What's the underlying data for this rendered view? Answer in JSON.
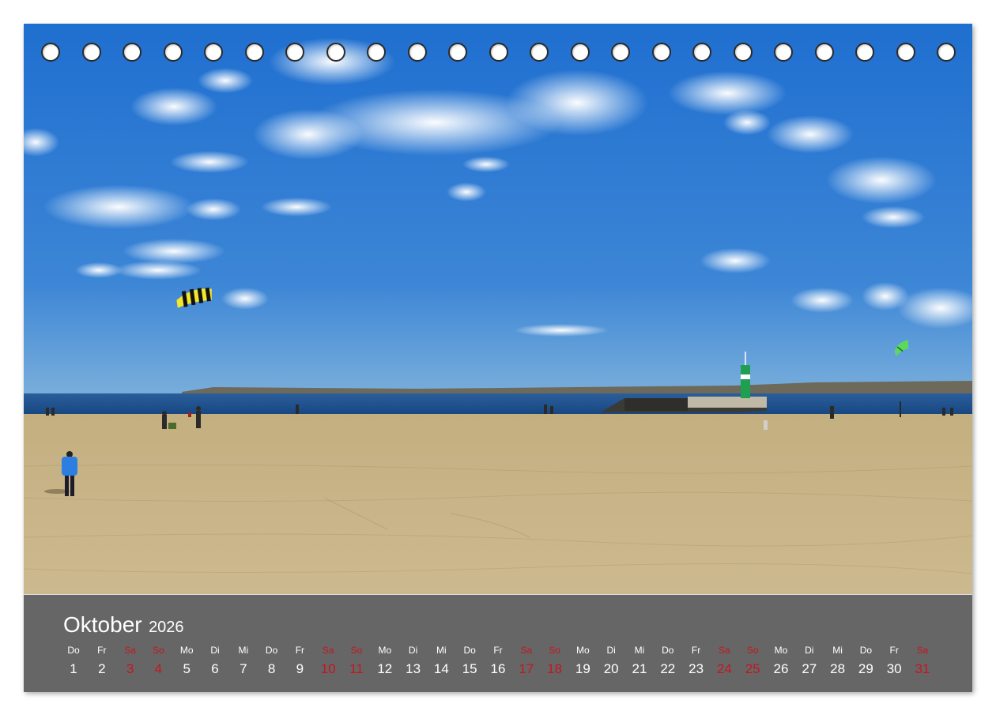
{
  "calendar": {
    "month": "Oktober",
    "year": "2026",
    "colors": {
      "panel": "#666666",
      "text": "#ffffff",
      "weekend": "#c8141e"
    },
    "days": [
      {
        "dow": "Do",
        "num": "1",
        "weekend": false
      },
      {
        "dow": "Fr",
        "num": "2",
        "weekend": false
      },
      {
        "dow": "Sa",
        "num": "3",
        "weekend": true
      },
      {
        "dow": "So",
        "num": "4",
        "weekend": true
      },
      {
        "dow": "Mo",
        "num": "5",
        "weekend": false
      },
      {
        "dow": "Di",
        "num": "6",
        "weekend": false
      },
      {
        "dow": "Mi",
        "num": "7",
        "weekend": false
      },
      {
        "dow": "Do",
        "num": "8",
        "weekend": false
      },
      {
        "dow": "Fr",
        "num": "9",
        "weekend": false
      },
      {
        "dow": "Sa",
        "num": "10",
        "weekend": true
      },
      {
        "dow": "So",
        "num": "11",
        "weekend": true
      },
      {
        "dow": "Mo",
        "num": "12",
        "weekend": false
      },
      {
        "dow": "Di",
        "num": "13",
        "weekend": false
      },
      {
        "dow": "Mi",
        "num": "14",
        "weekend": false
      },
      {
        "dow": "Do",
        "num": "15",
        "weekend": false
      },
      {
        "dow": "Fr",
        "num": "16",
        "weekend": false
      },
      {
        "dow": "Sa",
        "num": "17",
        "weekend": true
      },
      {
        "dow": "So",
        "num": "18",
        "weekend": true
      },
      {
        "dow": "Mo",
        "num": "19",
        "weekend": false
      },
      {
        "dow": "Di",
        "num": "20",
        "weekend": false
      },
      {
        "dow": "Mi",
        "num": "21",
        "weekend": false
      },
      {
        "dow": "Do",
        "num": "22",
        "weekend": false
      },
      {
        "dow": "Fr",
        "num": "23",
        "weekend": false
      },
      {
        "dow": "Sa",
        "num": "24",
        "weekend": true
      },
      {
        "dow": "So",
        "num": "25",
        "weekend": true
      },
      {
        "dow": "Mo",
        "num": "26",
        "weekend": false
      },
      {
        "dow": "Di",
        "num": "27",
        "weekend": false
      },
      {
        "dow": "Mi",
        "num": "28",
        "weekend": false
      },
      {
        "dow": "Do",
        "num": "29",
        "weekend": false
      },
      {
        "dow": "Fr",
        "num": "30",
        "weekend": false
      },
      {
        "dow": "Sa",
        "num": "31",
        "weekend": true
      }
    ]
  },
  "photo": {
    "colors": {
      "sky_top": "#1f6fd0",
      "sky_bottom": "#6aa3d8",
      "sea": "#1d4f8c",
      "sand": "#c8b58a"
    }
  }
}
